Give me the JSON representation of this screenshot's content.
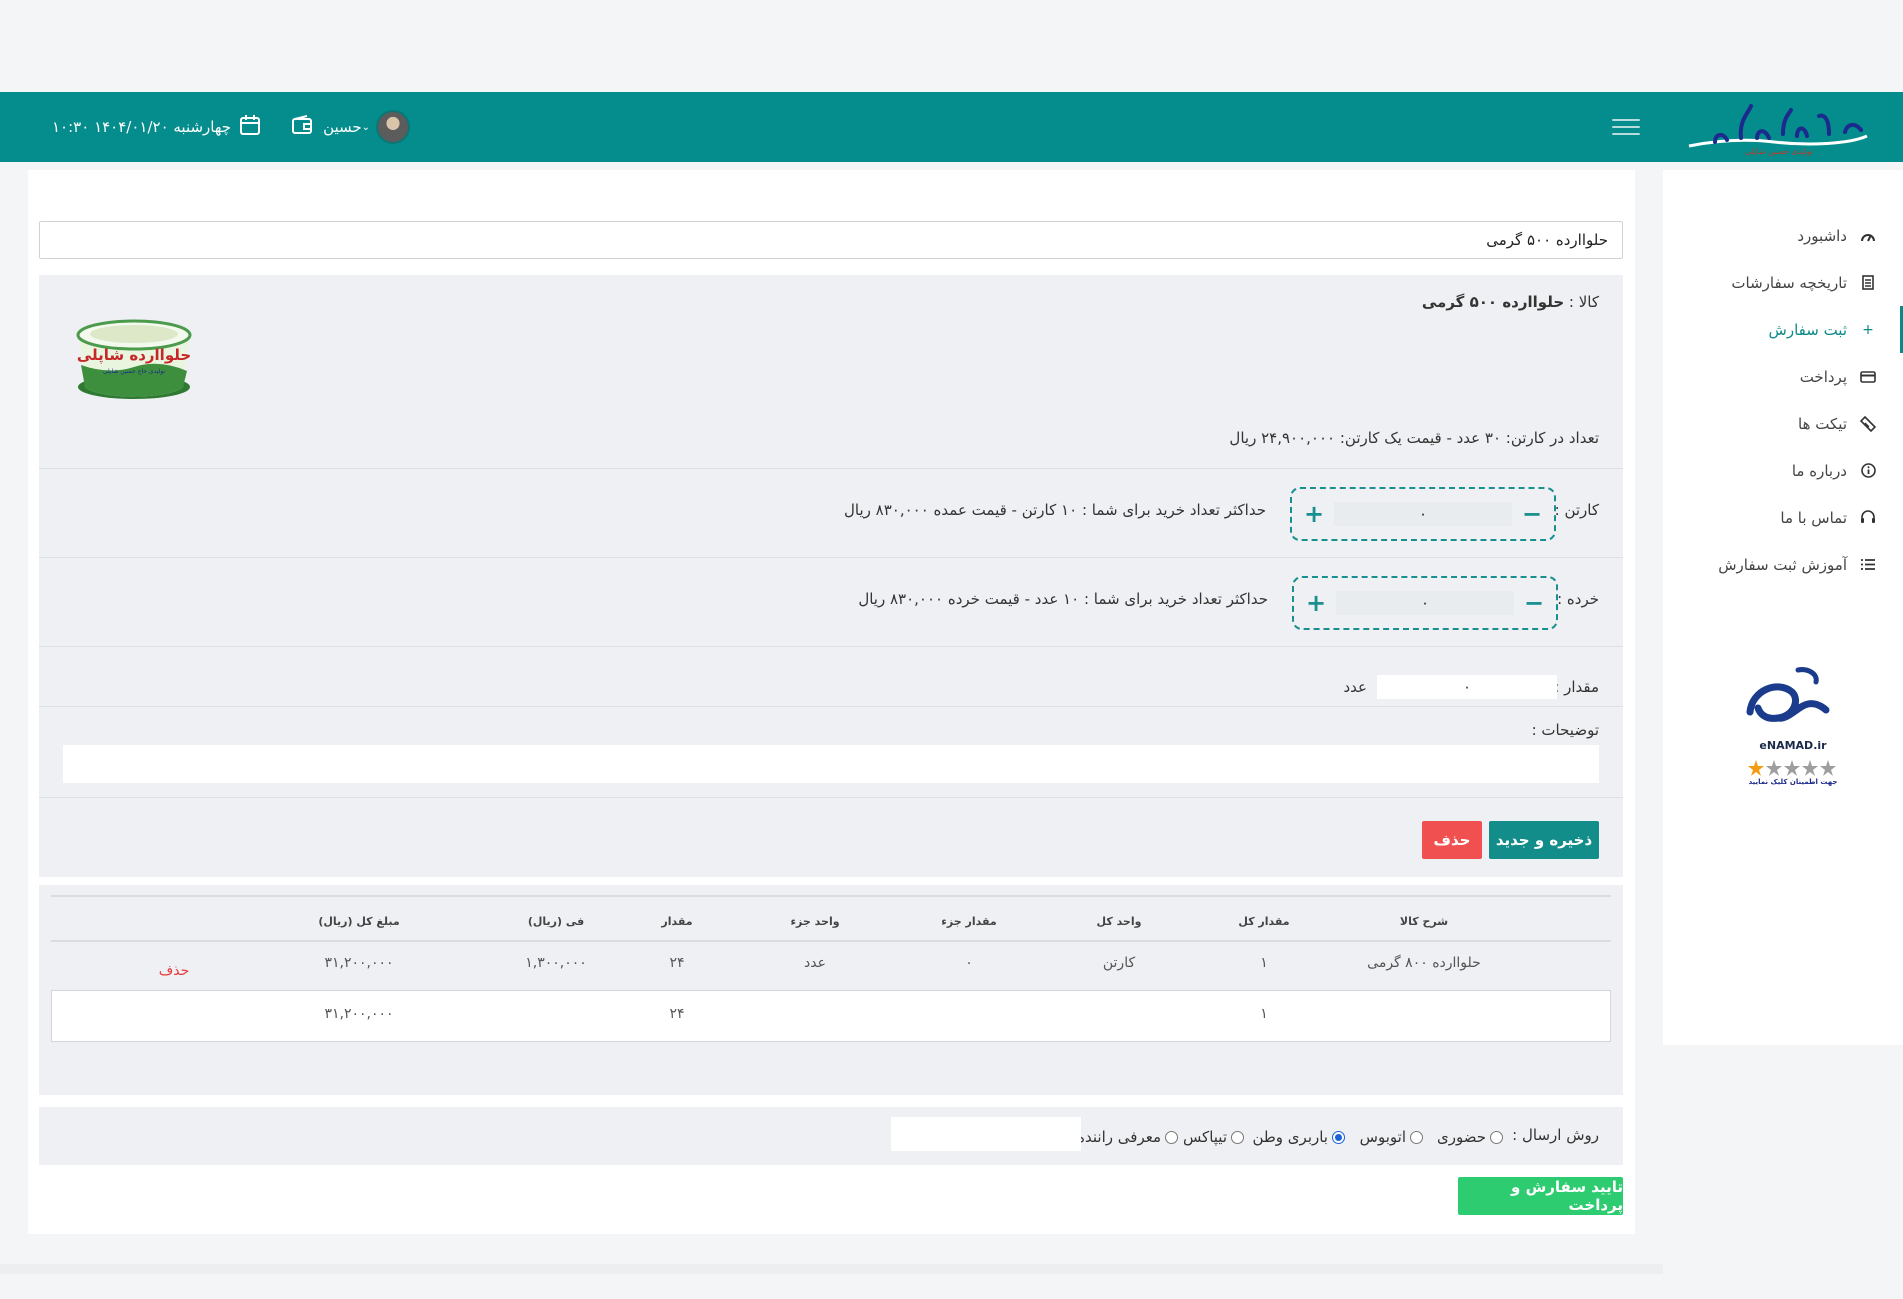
{
  "header": {
    "brand_name": "حلواارده شاپلی",
    "date_text": "چهارشنبه ۱۴۰۴/۰۱/۲۰ ۱۰:۳۰",
    "user_name": "حسین"
  },
  "sidebar": {
    "items": [
      {
        "label": "داشبورد",
        "icon": "gauge-icon"
      },
      {
        "label": "تاریخچه سفارشات",
        "icon": "document-icon"
      },
      {
        "label": "ثبت سفارش",
        "icon": "plus-icon"
      },
      {
        "label": "پرداخت",
        "icon": "credit-card-icon"
      },
      {
        "label": "تیکت ها",
        "icon": "ticket-icon"
      },
      {
        "label": "درباره ما",
        "icon": "info-icon"
      },
      {
        "label": "تماس با ما",
        "icon": "headset-icon"
      },
      {
        "label": "آموزش ثبت سفارش",
        "icon": "list-icon"
      }
    ],
    "active_index": 2,
    "enamad": {
      "label": "eNAMAD.ir",
      "caption": "جهت اطمینان کلیک نمایید",
      "stars_filled": 1,
      "stars_total": 5
    }
  },
  "search": {
    "value": "حلواارده ۵۰۰ گرمی"
  },
  "product": {
    "label": "کالا :",
    "name": "حلواارده ۵۰۰ گرمی",
    "carton_info": "تعداد در کارتن: ۳۰ عدد - قیمت یک کارتن: ۲۴,۹۰۰,۰۰۰ ریال",
    "carton_label": "کارتن :",
    "carton_value": "۰",
    "carton_note": "حداکثر تعداد خرید برای شما : ۱۰ کارتن - قیمت عمده ۸۳۰,۰۰۰ ریال",
    "retail_label": "خرده :",
    "retail_value": "۰",
    "retail_note": "حداکثر تعداد خرید برای شما : ۱۰ عدد - قیمت خرده ۸۳۰,۰۰۰ ریال",
    "amount_label": "مقدار :",
    "amount_value": "۰",
    "amount_unit": "عدد",
    "desc_label": "توضیحات :",
    "plus": "+",
    "minus": "−"
  },
  "buttons": {
    "save_new": "ذخیره و جدید",
    "delete": "حذف",
    "confirm": "تایید سفارش و پرداخت"
  },
  "table": {
    "headers": [
      "شرح کالا",
      "مقدار کل",
      "واحد کل",
      "مقدار جزء",
      "واحد جزء",
      "مقدار",
      "فی (ریال)",
      "مبلغ کل (ریال)"
    ],
    "rows": [
      {
        "desc": "حلواارده ۸۰۰ گرمی",
        "total_qty": "۱",
        "total_unit": "کارتن",
        "part_qty": "۰",
        "part_unit": "عدد",
        "qty": "۲۴",
        "price": "۱,۳۰۰,۰۰۰",
        "amount": "۳۱,۲۰۰,۰۰۰",
        "action": "حذف"
      }
    ],
    "totals": {
      "total_qty": "۱",
      "qty": "۲۴",
      "amount": "۳۱,۲۰۰,۰۰۰"
    }
  },
  "shipping": {
    "label": "روش ارسال :",
    "options": [
      "حضوری",
      "اتوبوس",
      "باربری وطن",
      "تیپاکس",
      "معرفی راننده :"
    ],
    "selected_index": 2
  },
  "colors": {
    "primary": "#058c8c",
    "danger": "#f05050",
    "success": "#2ecc71"
  }
}
